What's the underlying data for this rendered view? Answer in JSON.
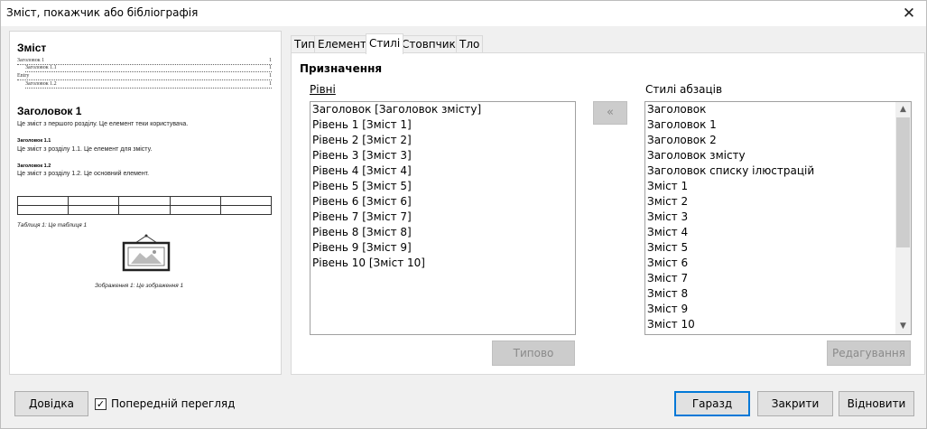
{
  "window": {
    "title": "Зміст, покажчик або бібліографія"
  },
  "preview": {
    "toc_title": "Зміст",
    "toc_entries": [
      {
        "text": "Заголовок 1",
        "page": "1"
      },
      {
        "text": "Заголовок 1.1",
        "page": "1"
      },
      {
        "text": "Entry",
        "page": "1"
      },
      {
        "text": "Заголовок 1.2",
        "page": "1"
      }
    ],
    "heading1": "Заголовок 1",
    "text1": "Це зміст з першого розділу. Це елемент теки користувача.",
    "heading11": "Заголовок 1.1",
    "text11": "Це зміст з розділу 1.1. Це елемент для змісту.",
    "heading12": "Заголовок 1.2",
    "text12": "Це зміст з розділу 1.2. Це основний елемент.",
    "table_caption": "Таблиця 1: Це таблиця 1",
    "image_caption": "Зображення 1: Це зображення 1"
  },
  "tabs": [
    "Тип",
    "Елементи",
    "Стилі",
    "Стовпчики",
    "Тло"
  ],
  "active_tab": "Стилі",
  "section_title": "Призначення",
  "levels": {
    "label": "Рівні",
    "items": [
      "Заголовок [Заголовок змісту]",
      "Рівень 1 [Зміст 1]",
      "Рівень 2 [Зміст 2]",
      "Рівень 3 [Зміст 3]",
      "Рівень 4 [Зміст 4]",
      "Рівень 5 [Зміст 5]",
      "Рівень 6 [Зміст 6]",
      "Рівень 7 [Зміст 7]",
      "Рівень 8 [Зміст 8]",
      "Рівень 9 [Зміст 9]",
      "Рівень 10 [Зміст 10]"
    ]
  },
  "assign_button": "«",
  "default_button": "Типово",
  "para_styles": {
    "label": "Стилі абзаців",
    "items": [
      "Заголовок",
      "Заголовок 1",
      "Заголовок 2",
      "Заголовок змісту",
      "Заголовок списку ілюстрацій",
      "Зміст 1",
      "Зміст 2",
      "Зміст 3",
      "Зміст 4",
      "Зміст 5",
      "Зміст 6",
      "Зміст 7",
      "Зміст 8",
      "Зміст 9",
      "Зміст 10"
    ]
  },
  "edit_button": "Редагування",
  "footer": {
    "help": "Довідка",
    "preview_label": "Попередній перегляд",
    "preview_checked": true,
    "ok": "Гаразд",
    "close": "Закрити",
    "reset": "Відновити"
  },
  "colors": {
    "accent": "#0078d7"
  }
}
